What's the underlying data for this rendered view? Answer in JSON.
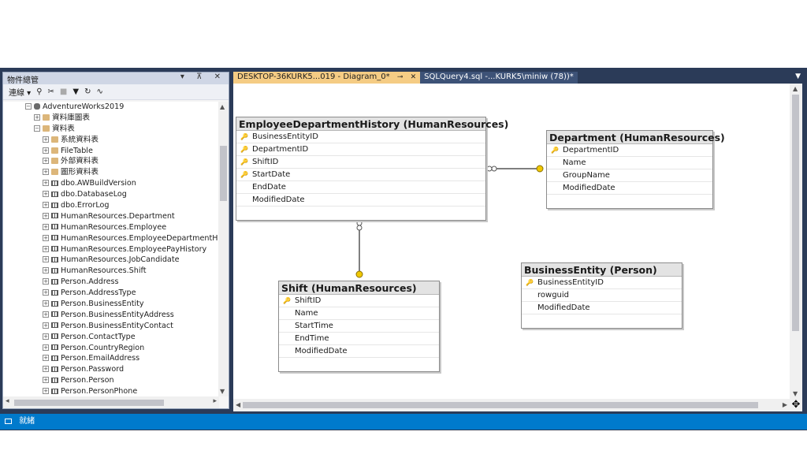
{
  "object_explorer": {
    "title": "物件總管",
    "title_buttons": "▾ ⊼ ✕",
    "toolbar": {
      "connect_label": "連線 ▾",
      "icons": [
        "connect-icon",
        "disconnect-icon",
        "stop-icon",
        "filter-icon",
        "refresh-icon",
        "activity-icon"
      ]
    },
    "tree": [
      {
        "expand": "⊟",
        "icon": "db",
        "label": "AdventureWorks2019",
        "indent": 0
      },
      {
        "expand": "⊞",
        "icon": "folder",
        "label": "資料庫圖表",
        "indent": 1
      },
      {
        "expand": "⊟",
        "icon": "folder",
        "label": "資料表",
        "indent": 1
      },
      {
        "expand": "⊞",
        "icon": "folder",
        "label": "系統資料表",
        "indent": 2
      },
      {
        "expand": "⊞",
        "icon": "folder",
        "label": "FileTable",
        "indent": 2
      },
      {
        "expand": "⊞",
        "icon": "folder",
        "label": "外部資料表",
        "indent": 2
      },
      {
        "expand": "⊞",
        "icon": "folder",
        "label": "圖形資料表",
        "indent": 2
      },
      {
        "expand": "⊞",
        "icon": "table",
        "label": "dbo.AWBuildVersion",
        "indent": 2
      },
      {
        "expand": "⊞",
        "icon": "table",
        "label": "dbo.DatabaseLog",
        "indent": 2
      },
      {
        "expand": "⊞",
        "icon": "table",
        "label": "dbo.ErrorLog",
        "indent": 2
      },
      {
        "expand": "⊞",
        "icon": "table",
        "label": "HumanResources.Department",
        "indent": 2
      },
      {
        "expand": "⊞",
        "icon": "table",
        "label": "HumanResources.Employee",
        "indent": 2
      },
      {
        "expand": "⊞",
        "icon": "table",
        "label": "HumanResources.EmployeeDepartmentHisto",
        "indent": 2
      },
      {
        "expand": "⊞",
        "icon": "table",
        "label": "HumanResources.EmployeePayHistory",
        "indent": 2
      },
      {
        "expand": "⊞",
        "icon": "table",
        "label": "HumanResources.JobCandidate",
        "indent": 2
      },
      {
        "expand": "⊞",
        "icon": "table",
        "label": "HumanResources.Shift",
        "indent": 2
      },
      {
        "expand": "⊞",
        "icon": "table",
        "label": "Person.Address",
        "indent": 2
      },
      {
        "expand": "⊞",
        "icon": "table",
        "label": "Person.AddressType",
        "indent": 2
      },
      {
        "expand": "⊞",
        "icon": "table",
        "label": "Person.BusinessEntity",
        "indent": 2
      },
      {
        "expand": "⊞",
        "icon": "table",
        "label": "Person.BusinessEntityAddress",
        "indent": 2
      },
      {
        "expand": "⊞",
        "icon": "table",
        "label": "Person.BusinessEntityContact",
        "indent": 2
      },
      {
        "expand": "⊞",
        "icon": "table",
        "label": "Person.ContactType",
        "indent": 2
      },
      {
        "expand": "⊞",
        "icon": "table",
        "label": "Person.CountryRegion",
        "indent": 2
      },
      {
        "expand": "⊞",
        "icon": "table",
        "label": "Person.EmailAddress",
        "indent": 2
      },
      {
        "expand": "⊞",
        "icon": "table",
        "label": "Person.Password",
        "indent": 2
      },
      {
        "expand": "⊞",
        "icon": "table",
        "label": "Person.Person",
        "indent": 2
      },
      {
        "expand": "⊞",
        "icon": "table",
        "label": "Person.PersonPhone",
        "indent": 2
      }
    ]
  },
  "tabs": [
    {
      "label": "DESKTOP-36KURK5...019 - Diagram_0*",
      "active": true,
      "pin": "⊸",
      "close": "✕"
    },
    {
      "label": "SQLQuery4.sql -...KURK5\\miniw (78))*",
      "active": false
    }
  ],
  "diagram": {
    "tables": [
      {
        "id": "edh",
        "title": "EmployeeDepartmentHistory (HumanResources)",
        "columns": [
          {
            "name": "BusinessEntityID",
            "key": true
          },
          {
            "name": "DepartmentID",
            "key": true
          },
          {
            "name": "ShiftID",
            "key": true
          },
          {
            "name": "StartDate",
            "key": true
          },
          {
            "name": "EndDate",
            "key": false
          },
          {
            "name": "ModifiedDate",
            "key": false
          }
        ]
      },
      {
        "id": "dept",
        "title": "Department (HumanResources)",
        "columns": [
          {
            "name": "DepartmentID",
            "key": true
          },
          {
            "name": "Name",
            "key": false
          },
          {
            "name": "GroupName",
            "key": false
          },
          {
            "name": "ModifiedDate",
            "key": false
          }
        ]
      },
      {
        "id": "shift",
        "title": "Shift (HumanResources)",
        "columns": [
          {
            "name": "ShiftID",
            "key": true
          },
          {
            "name": "Name",
            "key": false
          },
          {
            "name": "StartTime",
            "key": false
          },
          {
            "name": "EndTime",
            "key": false
          },
          {
            "name": "ModifiedDate",
            "key": false
          }
        ]
      },
      {
        "id": "be",
        "title": "BusinessEntity (Person)",
        "columns": [
          {
            "name": "BusinessEntityID",
            "key": true
          },
          {
            "name": "rowguid",
            "key": false
          },
          {
            "name": "ModifiedDate",
            "key": false
          }
        ]
      }
    ]
  },
  "status": {
    "text": "就緒"
  },
  "colors": {
    "status_bar": "#007acc",
    "active_tab": "#f5cc84",
    "frame": "#2b3b58",
    "key": "#c9a100"
  }
}
